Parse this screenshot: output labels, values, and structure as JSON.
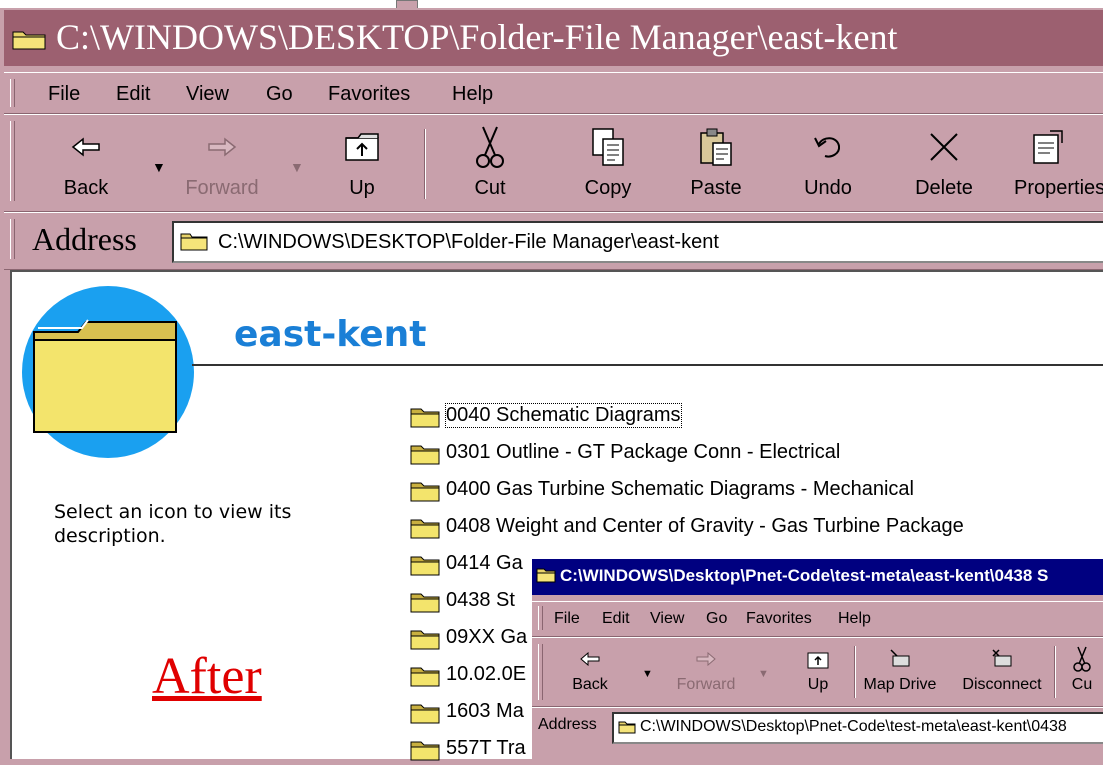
{
  "main_window": {
    "title": "C:\\WINDOWS\\DESKTOP\\Folder-File Manager\\east-kent",
    "menu": [
      "File",
      "Edit",
      "View",
      "Go",
      "Favorites",
      "Help"
    ],
    "toolbar": {
      "back": "Back",
      "forward": "Forward",
      "up": "Up",
      "cut": "Cut",
      "copy": "Copy",
      "paste": "Paste",
      "undo": "Undo",
      "delete": "Delete",
      "properties": "Properties"
    },
    "address_label": "Address",
    "address_value": "C:\\WINDOWS\\DESKTOP\\Folder-File Manager\\east-kent"
  },
  "content": {
    "folder_title": "east-kent",
    "description": "Select an icon to view its description.",
    "caption": "After",
    "files": [
      "0040 Schematic Diagrams",
      "0301 Outline - GT Package Conn - Electrical",
      "0400 Gas Turbine Schematic Diagrams - Mechanical",
      "0408 Weight and Center of Gravity - Gas Turbine Package",
      "0414 Ga",
      "0438  St",
      "09XX Ga",
      "10.02.0E",
      "1603 Ma",
      "557T Tra"
    ]
  },
  "overlay_window": {
    "title": "C:\\WINDOWS\\Desktop\\Pnet-Code\\test-meta\\east-kent\\0438  S",
    "menu": [
      "File",
      "Edit",
      "View",
      "Go",
      "Favorites",
      "Help"
    ],
    "toolbar": {
      "back": "Back",
      "forward": "Forward",
      "up": "Up",
      "map_drive": "Map Drive",
      "disconnect": "Disconnect",
      "cut": "Cu"
    },
    "address_label": "Address",
    "address_value": "C:\\WINDOWS\\Desktop\\Pnet-Code\\test-meta\\east-kent\\0438"
  },
  "colors": {
    "chrome": "#c8a0ab",
    "title_bar": "#9c6070",
    "overlay_title_bar": "#000080",
    "folder_title": "#1a7fd6",
    "caption": "#e00000"
  }
}
